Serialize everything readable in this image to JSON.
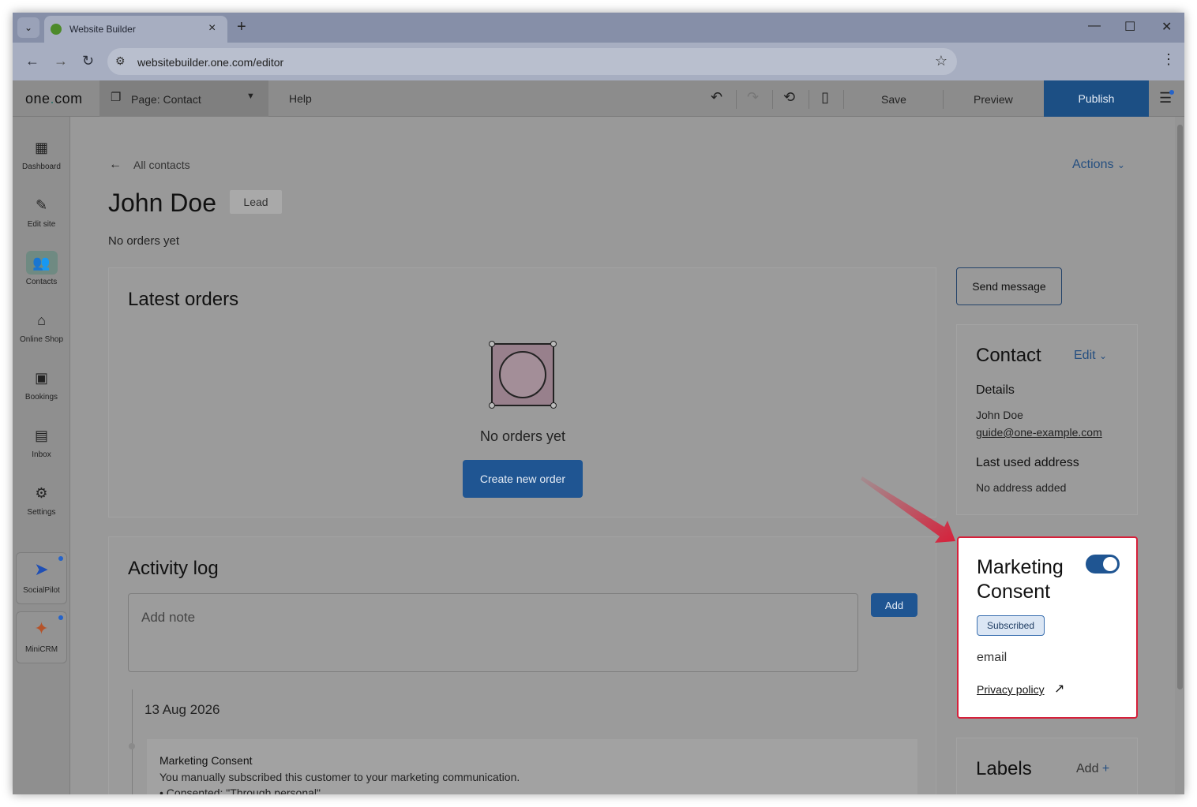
{
  "browser": {
    "tab_title": "Website Builder",
    "url": "websitebuilder.one.com/editor"
  },
  "toolbar": {
    "logo_prefix": "one",
    "logo_dot": ".",
    "logo_suffix": "com",
    "page_prefix": "Page: ",
    "page_name": "Contact",
    "help": "Help",
    "save": "Save",
    "preview": "Preview",
    "publish": "Publish"
  },
  "sidebar": {
    "items": [
      {
        "label": "Dashboard",
        "icon": "dashboard-icon"
      },
      {
        "label": "Edit site",
        "icon": "edit-site-icon"
      },
      {
        "label": "Contacts",
        "icon": "contacts-icon"
      },
      {
        "label": "Online Shop",
        "icon": "shop-icon"
      },
      {
        "label": "Bookings",
        "icon": "bookings-icon"
      },
      {
        "label": "Inbox",
        "icon": "inbox-icon"
      },
      {
        "label": "Settings",
        "icon": "gear-icon"
      }
    ],
    "apps": [
      {
        "label": "SocialPilot",
        "icon": "socialpilot-icon"
      },
      {
        "label": "MiniCRM",
        "icon": "minicrm-icon"
      }
    ]
  },
  "header": {
    "back_label": "All contacts",
    "actions": "Actions",
    "name": "John Doe",
    "badge": "Lead",
    "order_status": "No orders yet"
  },
  "orders": {
    "title": "Latest orders",
    "empty": "No orders yet",
    "create_button": "Create new order"
  },
  "activity": {
    "title": "Activity log",
    "note_placeholder": "Add note",
    "add_button": "Add",
    "date": "13 Aug 2026",
    "entry_title": "Marketing Consent",
    "entry_desc": "You manually subscribed this customer to your marketing communication.",
    "entry_bullet": "Consented: \"Through personal\""
  },
  "contact": {
    "send_button": "Send message",
    "title": "Contact",
    "edit": "Edit",
    "details_label": "Details",
    "name": "John Doe",
    "email": "guide@one-example.com",
    "address_label": "Last used address",
    "address": "No address added"
  },
  "marketing": {
    "title": "Marketing Consent",
    "enabled": true,
    "status": "Subscribed",
    "channel": "email",
    "privacy_link": "Privacy policy"
  },
  "labels": {
    "title": "Labels",
    "add": "Add"
  },
  "colors": {
    "accent": "#1f5592",
    "highlight_border": "#d6203a"
  }
}
